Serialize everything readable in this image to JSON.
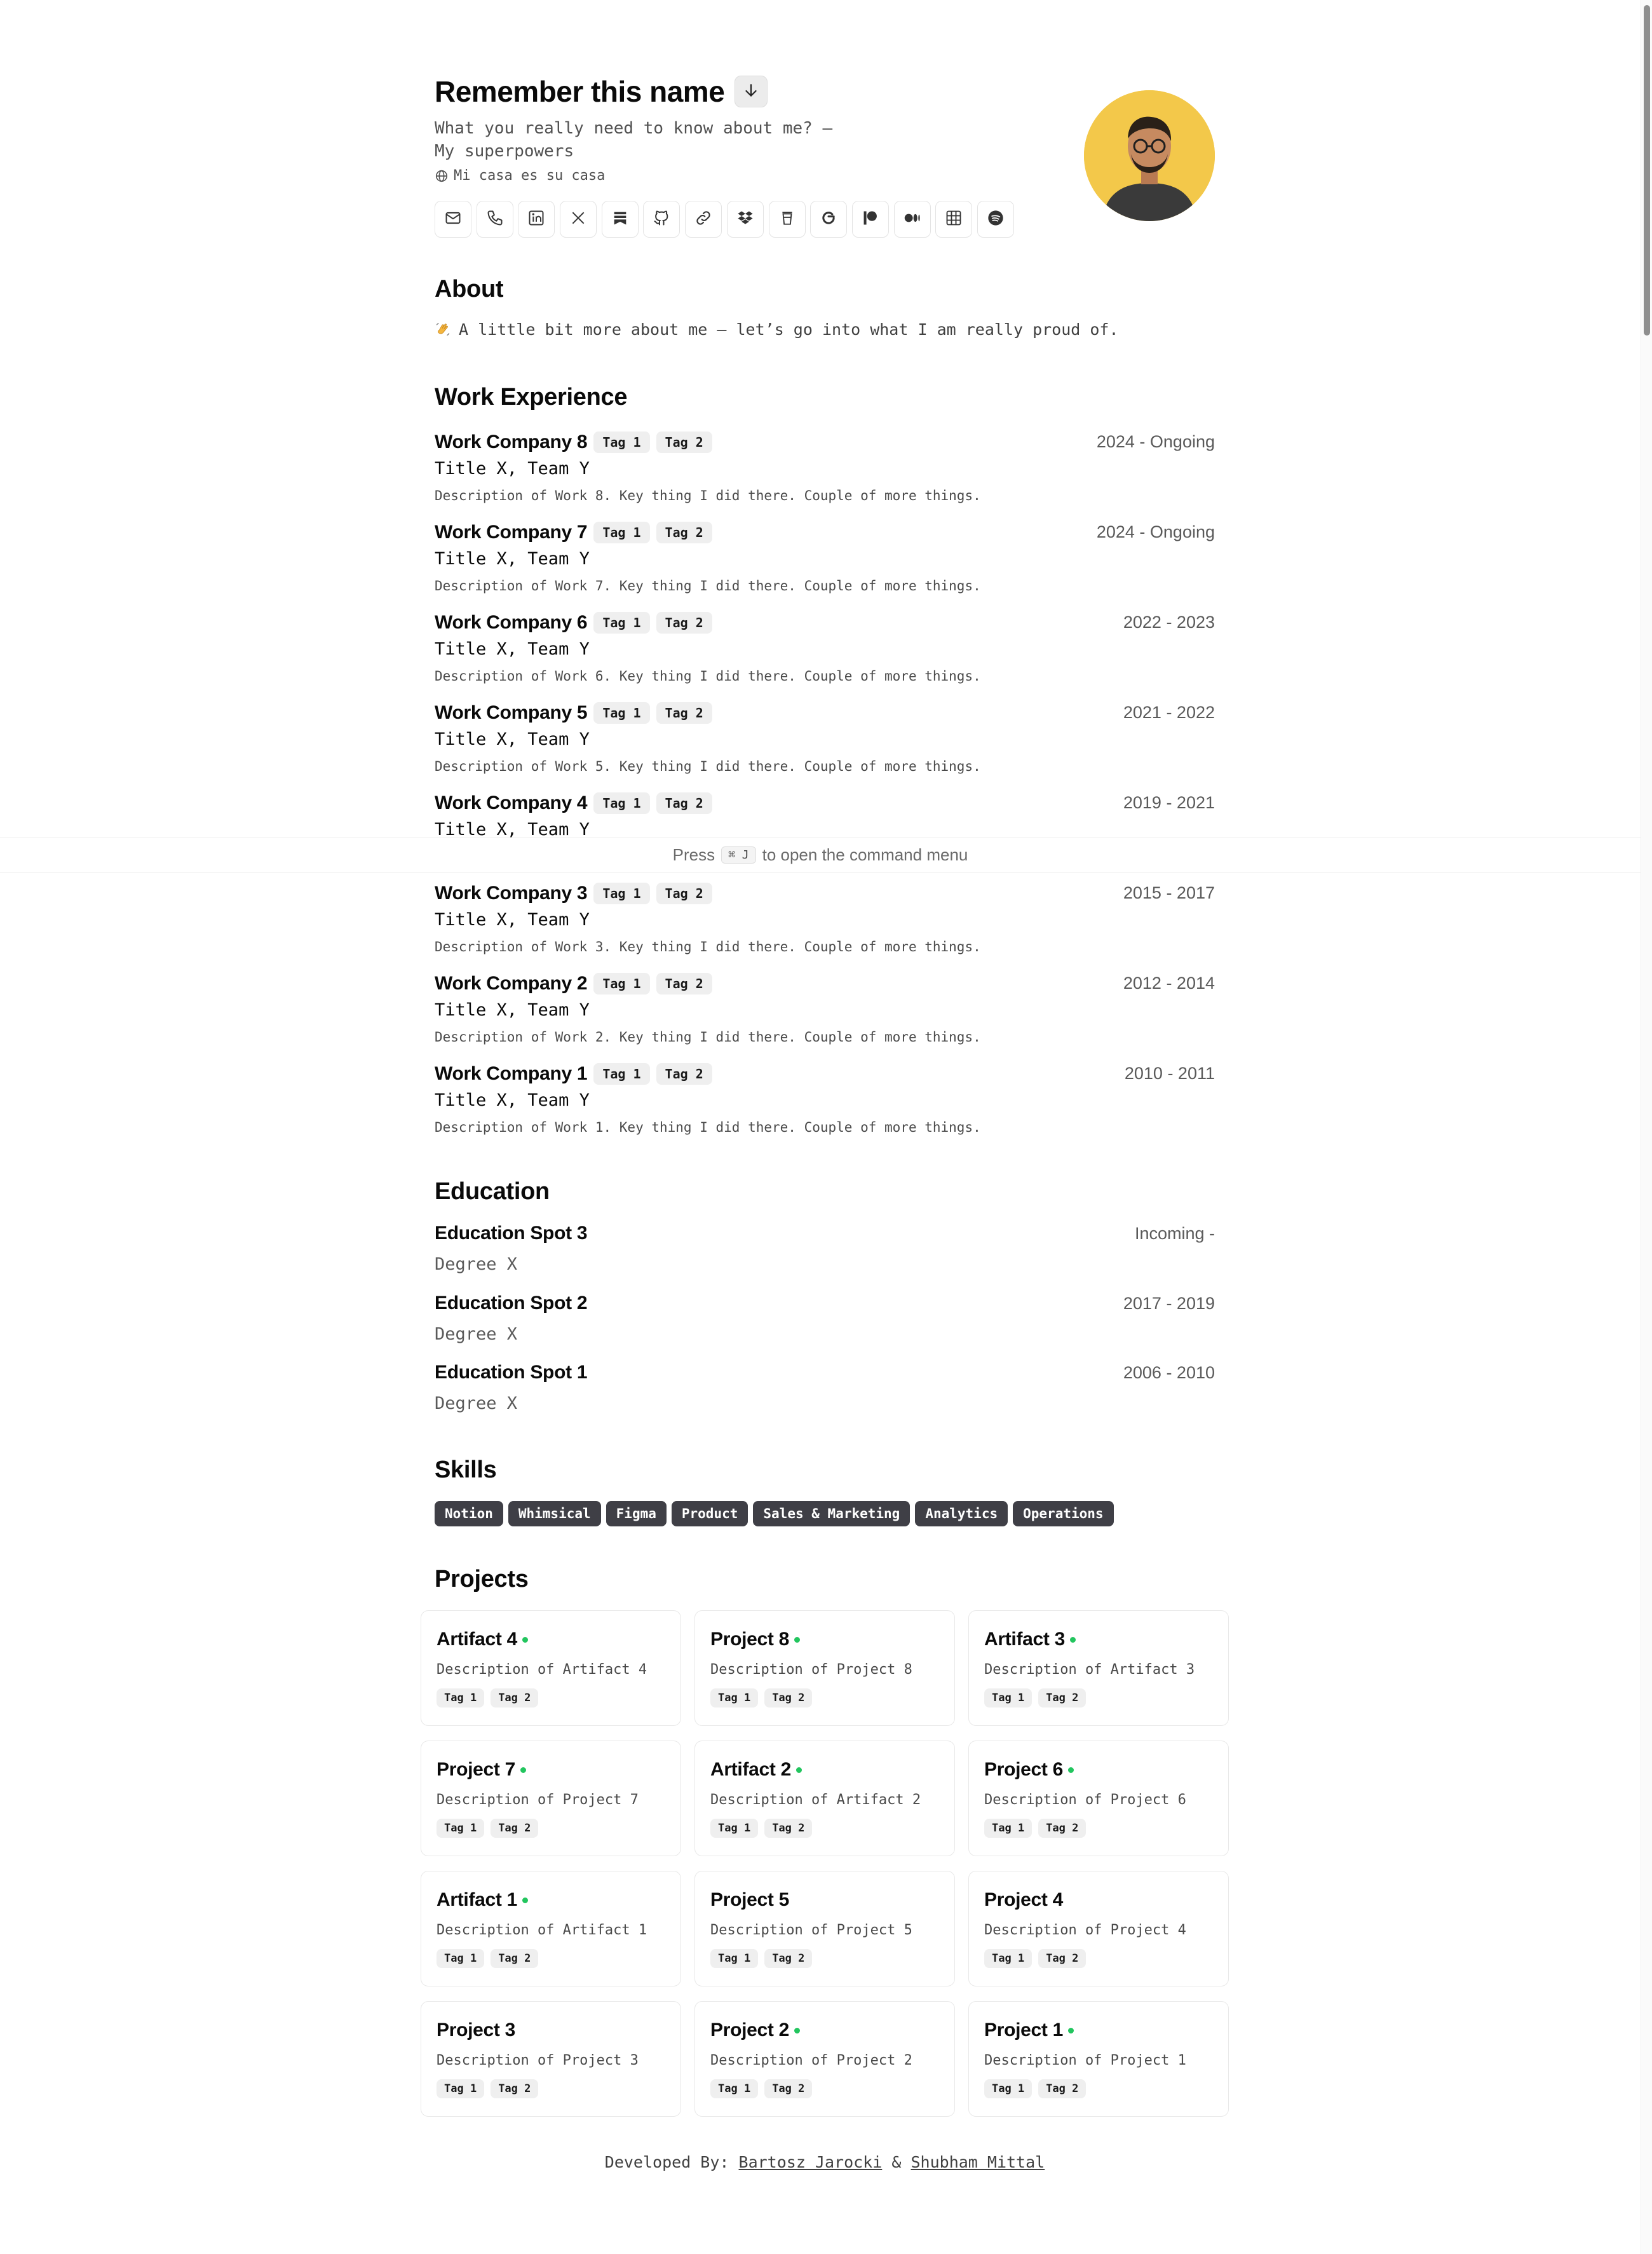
{
  "profile": {
    "name": "Remember this name",
    "tagline_line1": "What you really need to know about me? –",
    "tagline_line2": "My superpowers",
    "location": "Mi casa es su casa",
    "social_icons": [
      "mail-icon",
      "phone-icon",
      "linkedin-icon",
      "x-icon",
      "bookmark-icon",
      "github-icon",
      "link-icon",
      "dropbox-icon",
      "coffee-icon",
      "google-icon",
      "patreon-icon",
      "medium-icon",
      "grid-icon",
      "spotify-icon"
    ]
  },
  "about": {
    "title": "About",
    "text": "A little bit more about me — let’s go into what I am really proud of."
  },
  "work": {
    "title": "Work Experience",
    "items": [
      {
        "company": "Work Company 8",
        "tags": [
          "Tag 1",
          "Tag 2"
        ],
        "date": "2024 - Ongoing",
        "title": "Title X, Team Y",
        "description": "Description of Work 8. Key thing I did there. Couple of more things."
      },
      {
        "company": "Work Company 7",
        "tags": [
          "Tag 1",
          "Tag 2"
        ],
        "date": "2024 - Ongoing",
        "title": "Title X, Team Y",
        "description": "Description of Work 7. Key thing I did there. Couple of more things."
      },
      {
        "company": "Work Company 6",
        "tags": [
          "Tag 1",
          "Tag 2"
        ],
        "date": "2022 - 2023",
        "title": "Title X, Team Y",
        "description": "Description of Work 6. Key thing I did there. Couple of more things."
      },
      {
        "company": "Work Company 5",
        "tags": [
          "Tag 1",
          "Tag 2"
        ],
        "date": "2021 - 2022",
        "title": "Title X, Team Y",
        "description": "Description of Work 5. Key thing I did there. Couple of more things."
      },
      {
        "company": "Work Company 4",
        "tags": [
          "Tag 1",
          "Tag 2"
        ],
        "date": "2019 - 2021",
        "title": "Title X, Team Y",
        "description": ""
      },
      {
        "company": "Work Company 3",
        "tags": [
          "Tag 1",
          "Tag 2"
        ],
        "date": "2015 - 2017",
        "title": "Title X, Team Y",
        "description": "Description of Work 3. Key thing I did there. Couple of more things."
      },
      {
        "company": "Work Company 2",
        "tags": [
          "Tag 1",
          "Tag 2"
        ],
        "date": "2012 - 2014",
        "title": "Title X, Team Y",
        "description": "Description of Work 2. Key thing I did there. Couple of more things."
      },
      {
        "company": "Work Company 1",
        "tags": [
          "Tag 1",
          "Tag 2"
        ],
        "date": "2010 - 2011",
        "title": "Title X, Team Y",
        "description": "Description of Work 1. Key thing I did there. Couple of more things."
      }
    ]
  },
  "command_bar": {
    "prefix": "Press",
    "shortcut": "⌘ J",
    "suffix": "to open the command menu"
  },
  "education": {
    "title": "Education",
    "items": [
      {
        "school": "Education Spot 3",
        "date": "Incoming -",
        "degree": "Degree X"
      },
      {
        "school": "Education Spot 2",
        "date": "2017 - 2019",
        "degree": "Degree X"
      },
      {
        "school": "Education Spot 1",
        "date": "2006 - 2010",
        "degree": "Degree X"
      }
    ]
  },
  "skills": {
    "title": "Skills",
    "items": [
      "Notion",
      "Whimsical",
      "Figma",
      "Product",
      "Sales & Marketing",
      "Analytics",
      "Operations"
    ]
  },
  "projects": {
    "title": "Projects",
    "items": [
      {
        "name": "Artifact 4",
        "active": true,
        "description": "Description of Artifact 4",
        "tags": [
          "Tag 1",
          "Tag 2"
        ]
      },
      {
        "name": "Project 8",
        "active": true,
        "description": "Description of Project 8",
        "tags": [
          "Tag 1",
          "Tag 2"
        ]
      },
      {
        "name": "Artifact 3",
        "active": true,
        "description": "Description of Artifact 3",
        "tags": [
          "Tag 1",
          "Tag 2"
        ]
      },
      {
        "name": "Project 7",
        "active": true,
        "description": "Description of Project 7",
        "tags": [
          "Tag 1",
          "Tag 2"
        ]
      },
      {
        "name": "Artifact 2",
        "active": true,
        "description": "Description of Artifact 2",
        "tags": [
          "Tag 1",
          "Tag 2"
        ]
      },
      {
        "name": "Project 6",
        "active": true,
        "description": "Description of Project 6",
        "tags": [
          "Tag 1",
          "Tag 2"
        ]
      },
      {
        "name": "Artifact 1",
        "active": true,
        "description": "Description of Artifact 1",
        "tags": [
          "Tag 1",
          "Tag 2"
        ]
      },
      {
        "name": "Project 5",
        "active": false,
        "description": "Description of Project 5",
        "tags": [
          "Tag 1",
          "Tag 2"
        ]
      },
      {
        "name": "Project 4",
        "active": false,
        "description": "Description of Project 4",
        "tags": [
          "Tag 1",
          "Tag 2"
        ]
      },
      {
        "name": "Project 3",
        "active": false,
        "description": "Description of Project 3",
        "tags": [
          "Tag 1",
          "Tag 2"
        ]
      },
      {
        "name": "Project 2",
        "active": true,
        "description": "Description of Project 2",
        "tags": [
          "Tag 1",
          "Tag 2"
        ]
      },
      {
        "name": "Project 1",
        "active": true,
        "description": "Description of Project 1",
        "tags": [
          "Tag 1",
          "Tag 2"
        ]
      }
    ]
  },
  "footer": {
    "prefix": "Developed By:",
    "author1": "Bartosz Jarocki",
    "separator": "&",
    "author2": "Shubham Mittal"
  },
  "colors": {
    "accent_dot": "#22c55e",
    "avatar_bg": "#f3c84a",
    "skill_bg": "#3f3f46"
  }
}
